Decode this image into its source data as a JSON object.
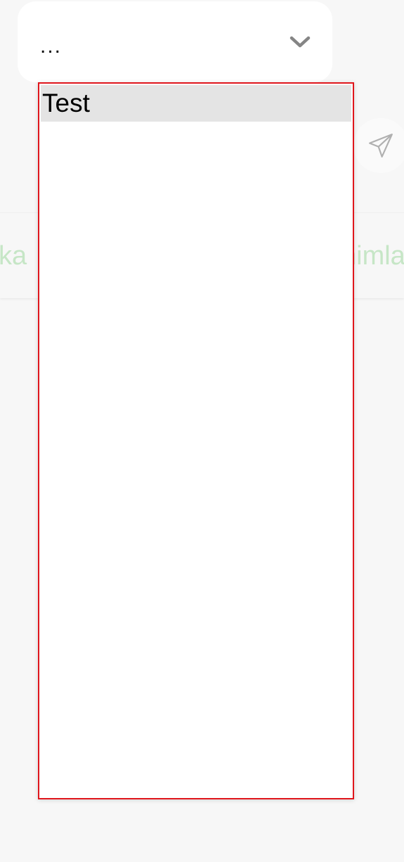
{
  "select": {
    "value": "...",
    "options": [
      "Test"
    ],
    "selected_index": 0
  },
  "tabs": {
    "left_partial": "ka",
    "right_partial": "nimla"
  },
  "icons": {
    "chevron": "chevron-down-icon",
    "send": "paper-plane-icon"
  },
  "colors": {
    "dropdown_border": "#e0161c",
    "selected_option_bg": "#e4e4e4",
    "tab_text": "#c6e6c6"
  }
}
